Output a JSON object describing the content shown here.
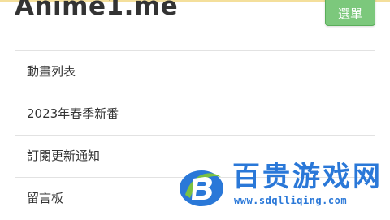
{
  "header": {
    "site_title": "Anime1.me",
    "menu_button_label": "選單"
  },
  "nav": {
    "items": [
      {
        "label": "動畫列表"
      },
      {
        "label": "2023年春季新番"
      },
      {
        "label": "訂閱更新通知"
      },
      {
        "label": "留言板"
      }
    ]
  },
  "watermark": {
    "title": "百贵游戏网",
    "url": "www.sdqlliqing.com"
  },
  "colors": {
    "menu_button_bg": "#7cc87c",
    "watermark_blue": "#2a78d8",
    "watermark_green": "#7ac143",
    "top_bar": "#f4df9b"
  }
}
